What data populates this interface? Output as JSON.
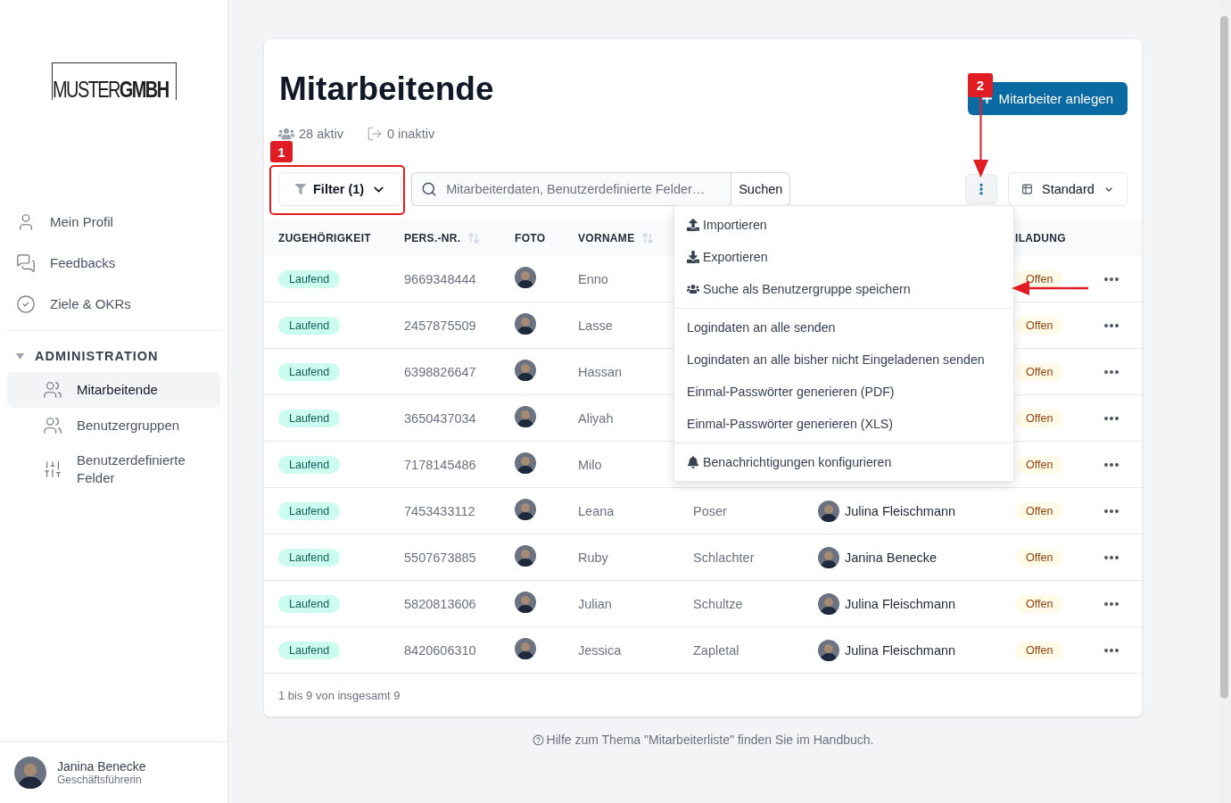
{
  "sidebar": {
    "logo": {
      "light": "MUSTER",
      "bold": "GMBH"
    },
    "items": [
      {
        "label": "Mein Profil",
        "selected": false
      },
      {
        "label": "Feedbacks",
        "selected": false
      },
      {
        "label": "Ziele & OKRs",
        "selected": false
      }
    ],
    "section": {
      "title": "ADMINISTRATION",
      "expanded": true,
      "items": [
        {
          "label": "Mitarbeitende",
          "selected": true
        },
        {
          "label": "Benutzergruppen",
          "selected": false
        },
        {
          "label": "Benutzerdefinierte Felder",
          "selected": false
        }
      ]
    },
    "user": {
      "name": "Janina Benecke",
      "role": "Geschäftsführerin"
    }
  },
  "page": {
    "title": "Mitarbeitende",
    "primary_button": "Mitarbeiter anlegen",
    "stats": [
      "28 aktiv",
      "0 inaktiv"
    ],
    "filter_button": "Filter (1)",
    "search": {
      "placeholder": "Mitarbeiterdaten, Benutzerdefinierte Felder…",
      "button": "Suchen"
    },
    "view_select": "Standard"
  },
  "menu": {
    "groups": [
      [
        "Importieren",
        "Exportieren",
        "Suche als Benutzergruppe speichern"
      ],
      [
        "Logindaten an alle senden",
        "Logindaten an alle bisher nicht Eingeladenen senden",
        "Einmal-Passwörter generieren (PDF)",
        "Einmal-Passwörter generieren (XLS)"
      ],
      [
        "Benachrichtigungen konfigurieren"
      ]
    ]
  },
  "table": {
    "columns": [
      {
        "label": "ZUGEHÖRIGKEIT",
        "sortable": false
      },
      {
        "label": "PERS.-NR.",
        "sortable": true
      },
      {
        "label": "FOTO",
        "sortable": false
      },
      {
        "label": "VORNAME",
        "sortable": true
      },
      {
        "label": "ILADUNG",
        "sortable": false
      }
    ],
    "rows": [
      {
        "membership": "Laufend",
        "number": "9669348444",
        "first_name": "Enno",
        "invitation": "Offen"
      },
      {
        "membership": "Laufend",
        "number": "2457875509",
        "first_name": "Lasse",
        "invitation": "Offen"
      },
      {
        "membership": "Laufend",
        "number": "6398826647",
        "first_name": "Hassan",
        "invitation": "Offen"
      },
      {
        "membership": "Laufend",
        "number": "3650437034",
        "first_name": "Aliyah",
        "invitation": "Offen"
      },
      {
        "membership": "Laufend",
        "number": "7178145486",
        "first_name": "Milo",
        "invitation": "Offen"
      },
      {
        "membership": "Laufend",
        "number": "7453433112",
        "first_name": "Leana",
        "last_name": "Poser",
        "manager": "Julina Fleischmann",
        "invitation": "Offen"
      },
      {
        "membership": "Laufend",
        "number": "5507673885",
        "first_name": "Ruby",
        "last_name": "Schlachter",
        "manager": "Janina Benecke",
        "invitation": "Offen"
      },
      {
        "membership": "Laufend",
        "number": "5820813606",
        "first_name": "Julian",
        "last_name": "Schultze",
        "manager": "Julina Fleischmann",
        "invitation": "Offen"
      },
      {
        "membership": "Laufend",
        "number": "8420606310",
        "first_name": "Jessica",
        "last_name": "Zapletal",
        "manager": "Julina Fleischmann",
        "invitation": "Offen"
      }
    ],
    "summary": "1 bis 9 von insgesamt 9"
  },
  "help": "Hilfe zum Thema \"Mitarbeiterliste\" finden Sie im Handbuch.",
  "annotations": [
    {
      "label": "1"
    },
    {
      "label": "2"
    }
  ]
}
